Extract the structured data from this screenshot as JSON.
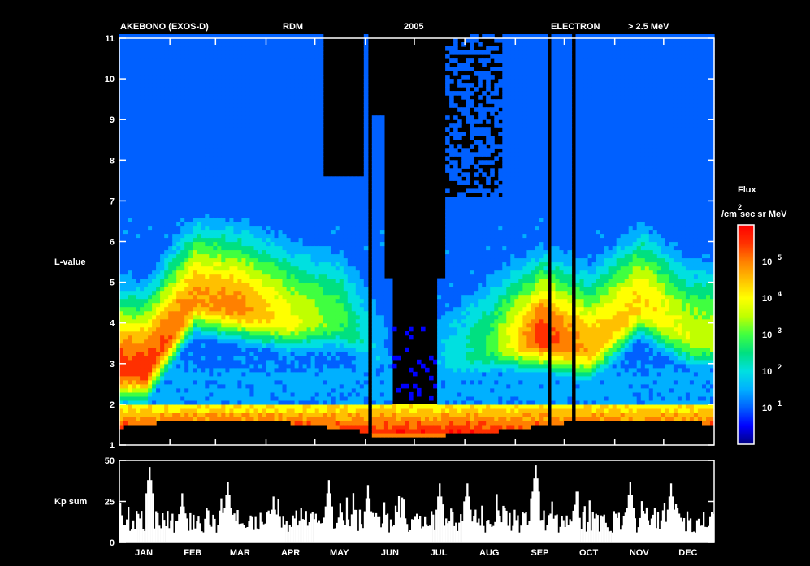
{
  "header": {
    "satellite": "AKEBONO (EXOS-D)",
    "instrument": "RDM",
    "year": "2005",
    "particle": "ELECTRON",
    "energy": "> 2.5 MeV"
  },
  "colorbar": {
    "title": "Flux",
    "unit_base": "/cm",
    "unit_exp": "2",
    "unit_rest": "sec sr MeV",
    "labels": [
      {
        "base": "10",
        "exp": "5",
        "value": 100000
      },
      {
        "base": "10",
        "exp": "4",
        "value": 10000
      },
      {
        "base": "10",
        "exp": "3",
        "value": 1000
      },
      {
        "base": "10",
        "exp": "2",
        "value": 100
      },
      {
        "base": "10",
        "exp": "1",
        "value": 10
      }
    ],
    "colors": [
      "#000080",
      "#0000ff",
      "#0060ff",
      "#00b0ff",
      "#00e0e0",
      "#00e080",
      "#40ff40",
      "#c0ff00",
      "#ffff00",
      "#ffc000",
      "#ff8000",
      "#ff3000",
      "#ff0000"
    ]
  },
  "chart_data": [
    {
      "type": "heatmap",
      "ylabel": "L-value",
      "ylim": [
        1,
        11
      ],
      "yticks": [
        "1",
        "2",
        "3",
        "4",
        "5",
        "6",
        "7",
        "8",
        "9",
        "10",
        "11"
      ],
      "xlim": [
        0,
        365
      ],
      "months": [
        "JAN",
        "FEB",
        "MAR",
        "APR",
        "MAY",
        "JUN",
        "JUL",
        "AUG",
        "SEP",
        "OCT",
        "NOV",
        "DEC"
      ],
      "month_days": [
        15,
        45,
        74,
        105,
        135,
        166,
        196,
        227,
        258,
        288,
        319,
        349
      ],
      "description_values": {
        "slot_region_L": [
          2.2,
          3.0
        ],
        "inner_belt_L": [
          1.4,
          2.0
        ],
        "data_gap_days": [
          [
            148,
            152
          ],
          [
            175,
            195
          ],
          [
            168,
            200
          ]
        ]
      },
      "outer_belt_profile": [
        {
          "month": "JAN",
          "peak_L": 2.8,
          "peak_log_flux": 4.6
        },
        {
          "month": "FEB",
          "peak_L": 4.5,
          "peak_log_flux": 4.0
        },
        {
          "month": "MAR",
          "peak_L": 4.3,
          "peak_log_flux": 4.1
        },
        {
          "month": "APR",
          "peak_L": 4.0,
          "peak_log_flux": 3.2
        },
        {
          "month": "MAY",
          "peak_L": 4.0,
          "peak_log_flux": 2.4
        },
        {
          "month": "JUN",
          "peak_L": 3.0,
          "peak_log_flux": 1.0
        },
        {
          "month": "JUL",
          "peak_L": 3.0,
          "peak_log_flux": 1.4
        },
        {
          "month": "AUG",
          "peak_L": 3.4,
          "peak_log_flux": 2.4
        },
        {
          "month": "SEP",
          "peak_L": 3.6,
          "peak_log_flux": 4.7
        },
        {
          "month": "OCT",
          "peak_L": 3.3,
          "peak_log_flux": 3.8
        },
        {
          "month": "NOV",
          "peak_L": 4.4,
          "peak_log_flux": 3.6
        },
        {
          "month": "DEC",
          "peak_L": 3.6,
          "peak_log_flux": 3.0
        }
      ]
    },
    {
      "type": "bar",
      "ylabel": "Kp sum",
      "ylim": [
        0,
        50
      ],
      "yticks": [
        "0",
        "25",
        "50"
      ],
      "xlim": [
        0,
        365
      ],
      "monthly_peaks": [
        {
          "month": "JAN",
          "day": 18,
          "value": 46
        },
        {
          "month": "FEB",
          "day": 38,
          "value": 30
        },
        {
          "month": "MAR",
          "day": 66,
          "value": 37
        },
        {
          "month": "APR",
          "day": 94,
          "value": 28
        },
        {
          "month": "MAY",
          "day": 128,
          "value": 38
        },
        {
          "month": "JUN",
          "day": 152,
          "value": 35
        },
        {
          "month": "JUL",
          "day": 196,
          "value": 36
        },
        {
          "month": "AUG",
          "day": 213,
          "value": 36
        },
        {
          "month": "SEP",
          "day": 255,
          "value": 47
        },
        {
          "month": "OCT",
          "day": 280,
          "value": 31
        },
        {
          "month": "NOV",
          "day": 313,
          "value": 37
        },
        {
          "month": "DEC",
          "day": 338,
          "value": 36
        }
      ]
    }
  ]
}
